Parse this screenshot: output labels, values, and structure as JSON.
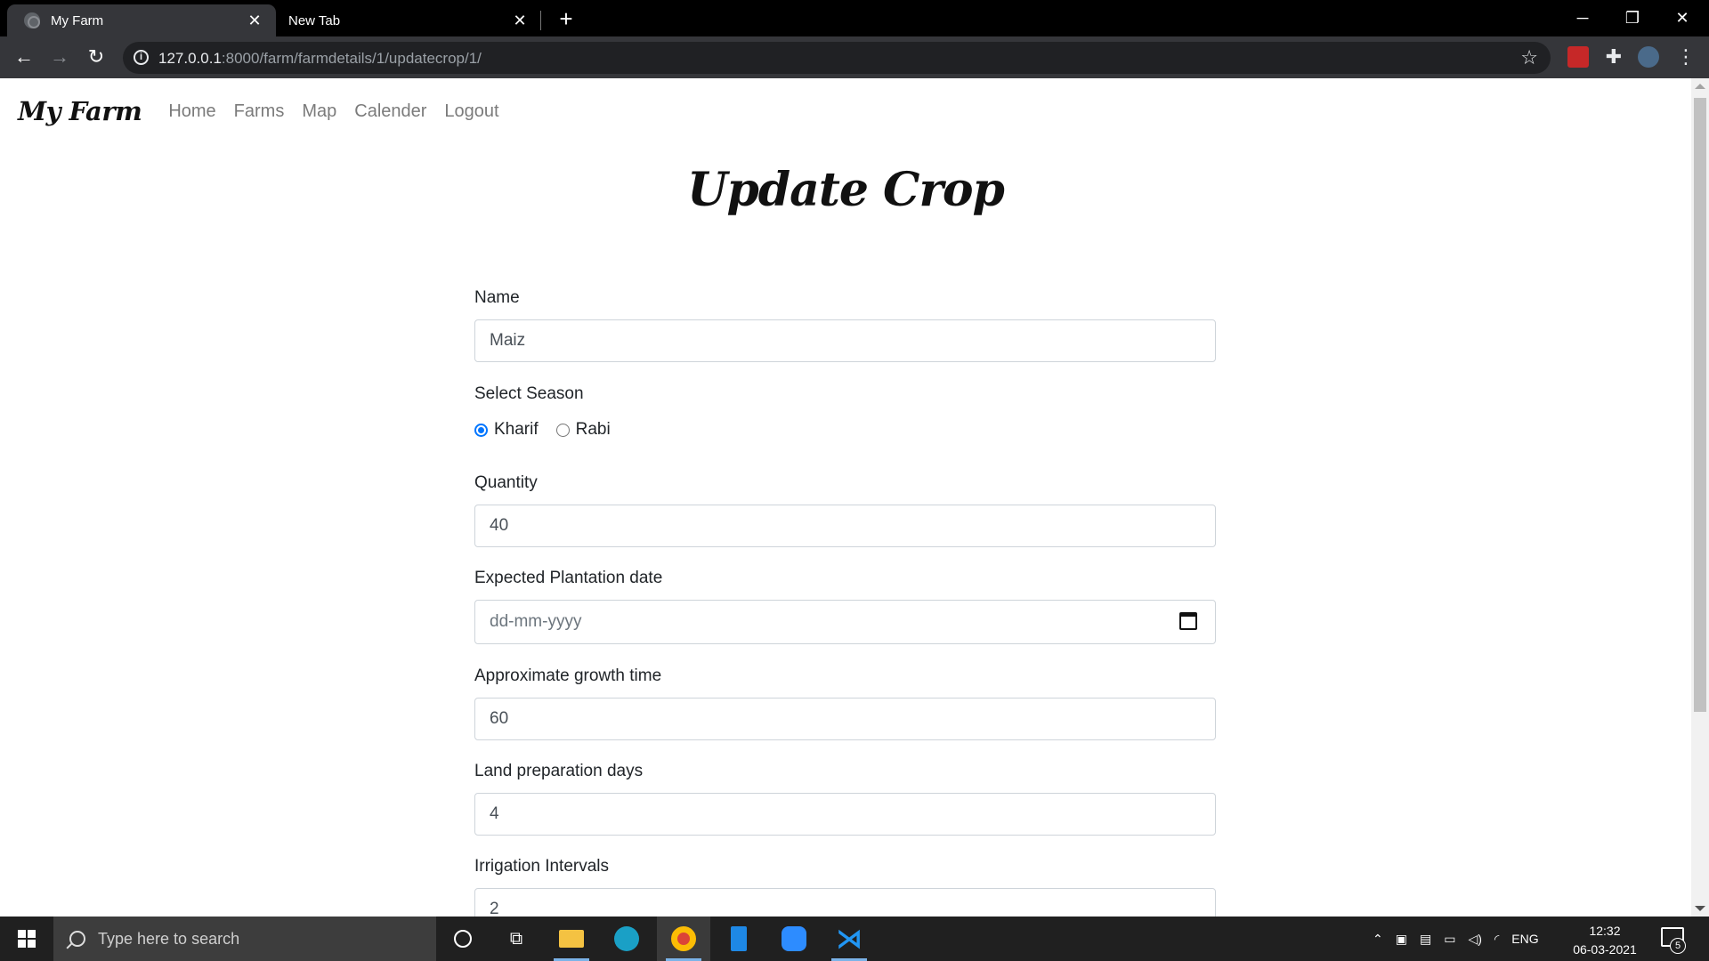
{
  "browser": {
    "tabs": [
      {
        "title": "My Farm",
        "active": true
      },
      {
        "title": "New Tab",
        "active": false
      }
    ],
    "url_host": "127.0.0.1",
    "url_path": ":8000/farm/farmdetails/1/updatecrop/1/"
  },
  "navbar": {
    "brand": "My Farm",
    "links": [
      "Home",
      "Farms",
      "Map",
      "Calender",
      "Logout"
    ]
  },
  "page": {
    "title": "Update Crop"
  },
  "form": {
    "name_label": "Name",
    "name_value": "Maiz",
    "season_label": "Select Season",
    "season_options": [
      "Kharif",
      "Rabi"
    ],
    "season_selected": "Kharif",
    "quantity_label": "Quantity",
    "quantity_value": "40",
    "plantation_label": "Expected Plantation date",
    "plantation_placeholder": "dd-mm-yyyy",
    "growth_label": "Approximate growth time",
    "growth_value": "60",
    "landprep_label": "Land preparation days",
    "landprep_value": "4",
    "irrigation_label": "Irrigation Intervals",
    "irrigation_value": "2"
  },
  "taskbar": {
    "search_placeholder": "Type here to search",
    "language": "ENG",
    "time": "12:32",
    "date": "06-03-2021",
    "notification_count": "5",
    "accent_color": "#7bb3e8"
  }
}
